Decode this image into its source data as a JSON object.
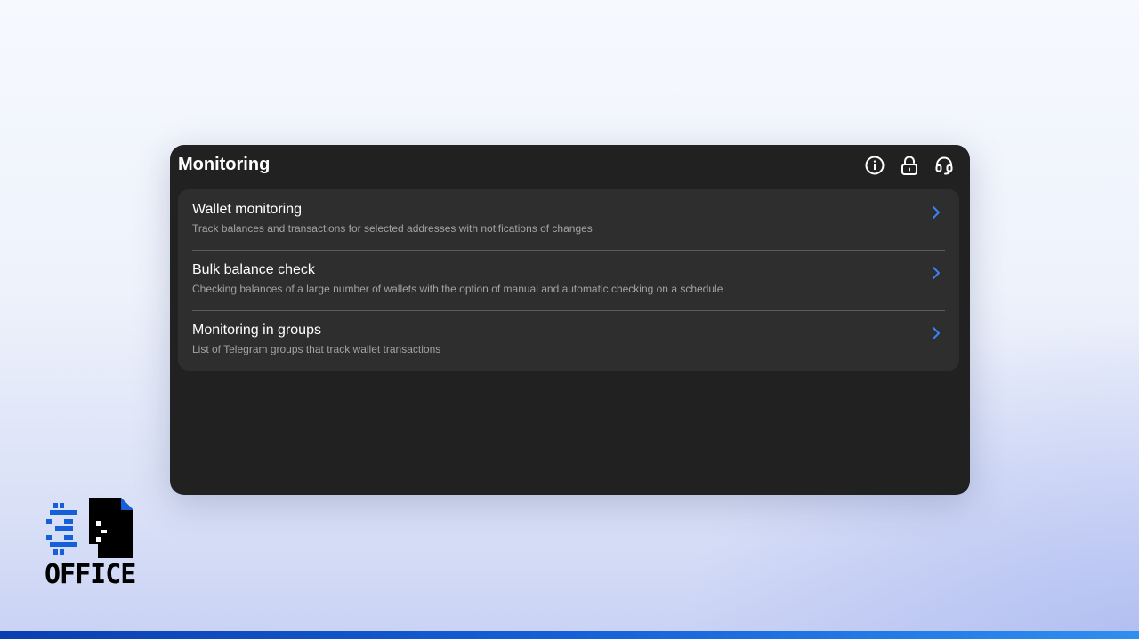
{
  "panel": {
    "title": "Monitoring",
    "header_icons": [
      "info-icon",
      "lock-icon",
      "headset-icon"
    ]
  },
  "items": [
    {
      "title": "Wallet monitoring",
      "description": "Track balances and transactions for selected addresses with notifications of changes"
    },
    {
      "title": "Bulk balance check",
      "description": "Checking balances of a large number of wallets with the option of manual and automatic checking on a schedule"
    },
    {
      "title": "Monitoring in groups",
      "description": "List of Telegram groups that track wallet transactions"
    }
  ],
  "logo": {
    "text": "OFFICE"
  },
  "colors": {
    "panel_bg": "#212121",
    "list_bg": "#2e2e2e",
    "accent": "#3b82f6",
    "brand_blue": "#1560d8"
  }
}
